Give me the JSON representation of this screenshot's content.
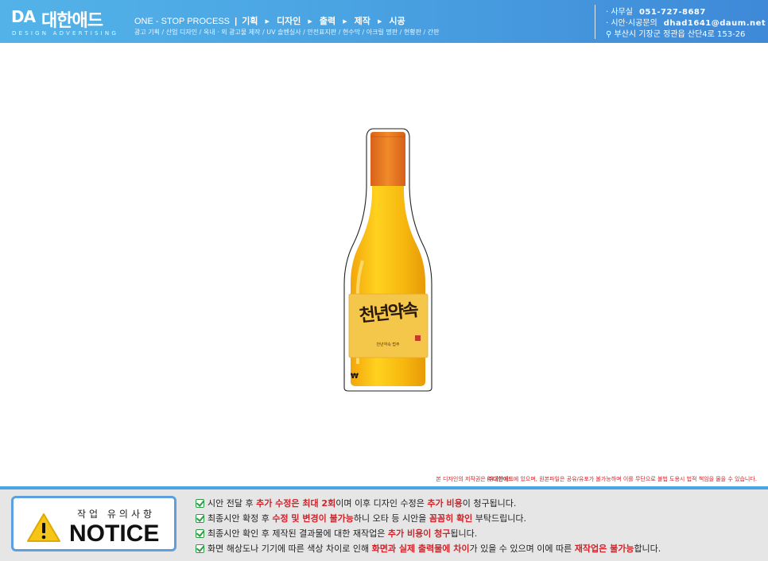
{
  "header": {
    "logo_mark": "DA",
    "logo_name": "대한애드",
    "logo_sub": "DESIGN ADVERTISING",
    "process_intro": "ONE - STOP PROCESS",
    "process_sep": "|",
    "process_steps": [
      "기획",
      "디자인",
      "출력",
      "제작",
      "시공"
    ],
    "services": "광고 기획 / 산업 디자인 / 옥내 · 외 광고물 제작 / UV 솔벤실사 / 안전표지판 / 현수막 / 아크릴 명판 / 현황판 / 간판",
    "contact": {
      "office_label": "· 사무실",
      "office_phone": "051-727-8687",
      "email_label": "· 시안·시공문의",
      "email": "dhad1641@daum.net",
      "address": "부산시 기장군 정관읍 산단4로 153-26"
    }
  },
  "proof": {
    "label_title": "천년약속",
    "label_sub": "천년약속 법주",
    "price_mark": "₩"
  },
  "copyright": {
    "pre": "본 디자인의 저작권은 ",
    "brand": "㈜대한애드",
    "post": "에 있으며, 원본파일은 공유/유포가 불가능하며 이를 무단으로 불법 도용시 법적 책임을 물을 수 있습니다."
  },
  "notice": {
    "small": "작업 유의사항",
    "big": "NOTICE",
    "lines": [
      {
        "a": "시안 전달 후 ",
        "b": "추가 수정은 최대 2회",
        "c": "이며 이후 디자인 수정은 ",
        "d": "추가 비용",
        "e": "이 청구됩니다."
      },
      {
        "a": "최종시안 확정 후 ",
        "b": "수정 및 변경이 불가능",
        "c": "하니 오타 등 시안을 ",
        "d": "꼼꼼히 확인",
        "e": " 부탁드립니다."
      },
      {
        "a": "최종시안 확인 후 제작된 결과물에 대한 재작업은 ",
        "b": "추가 비용이 청구",
        "c": "됩니다.",
        "d": "",
        "e": ""
      },
      {
        "a": "화면 해상도나 기기에 따른 색상 차이로 인해 ",
        "b": "화면과 실제 출력물에 차이",
        "c": "가 있을 수 있으며 이에 따른 ",
        "d": "재작업은 불가능",
        "e": "합니다."
      }
    ]
  },
  "colors": {
    "header_blue": "#4aa3e2",
    "highlight_red": "#d2232a",
    "check_green": "#2f9a44",
    "bottle_cap": "#e5731f",
    "bottle_body": "#f5b40f",
    "label_bg": "#f4c64a"
  }
}
